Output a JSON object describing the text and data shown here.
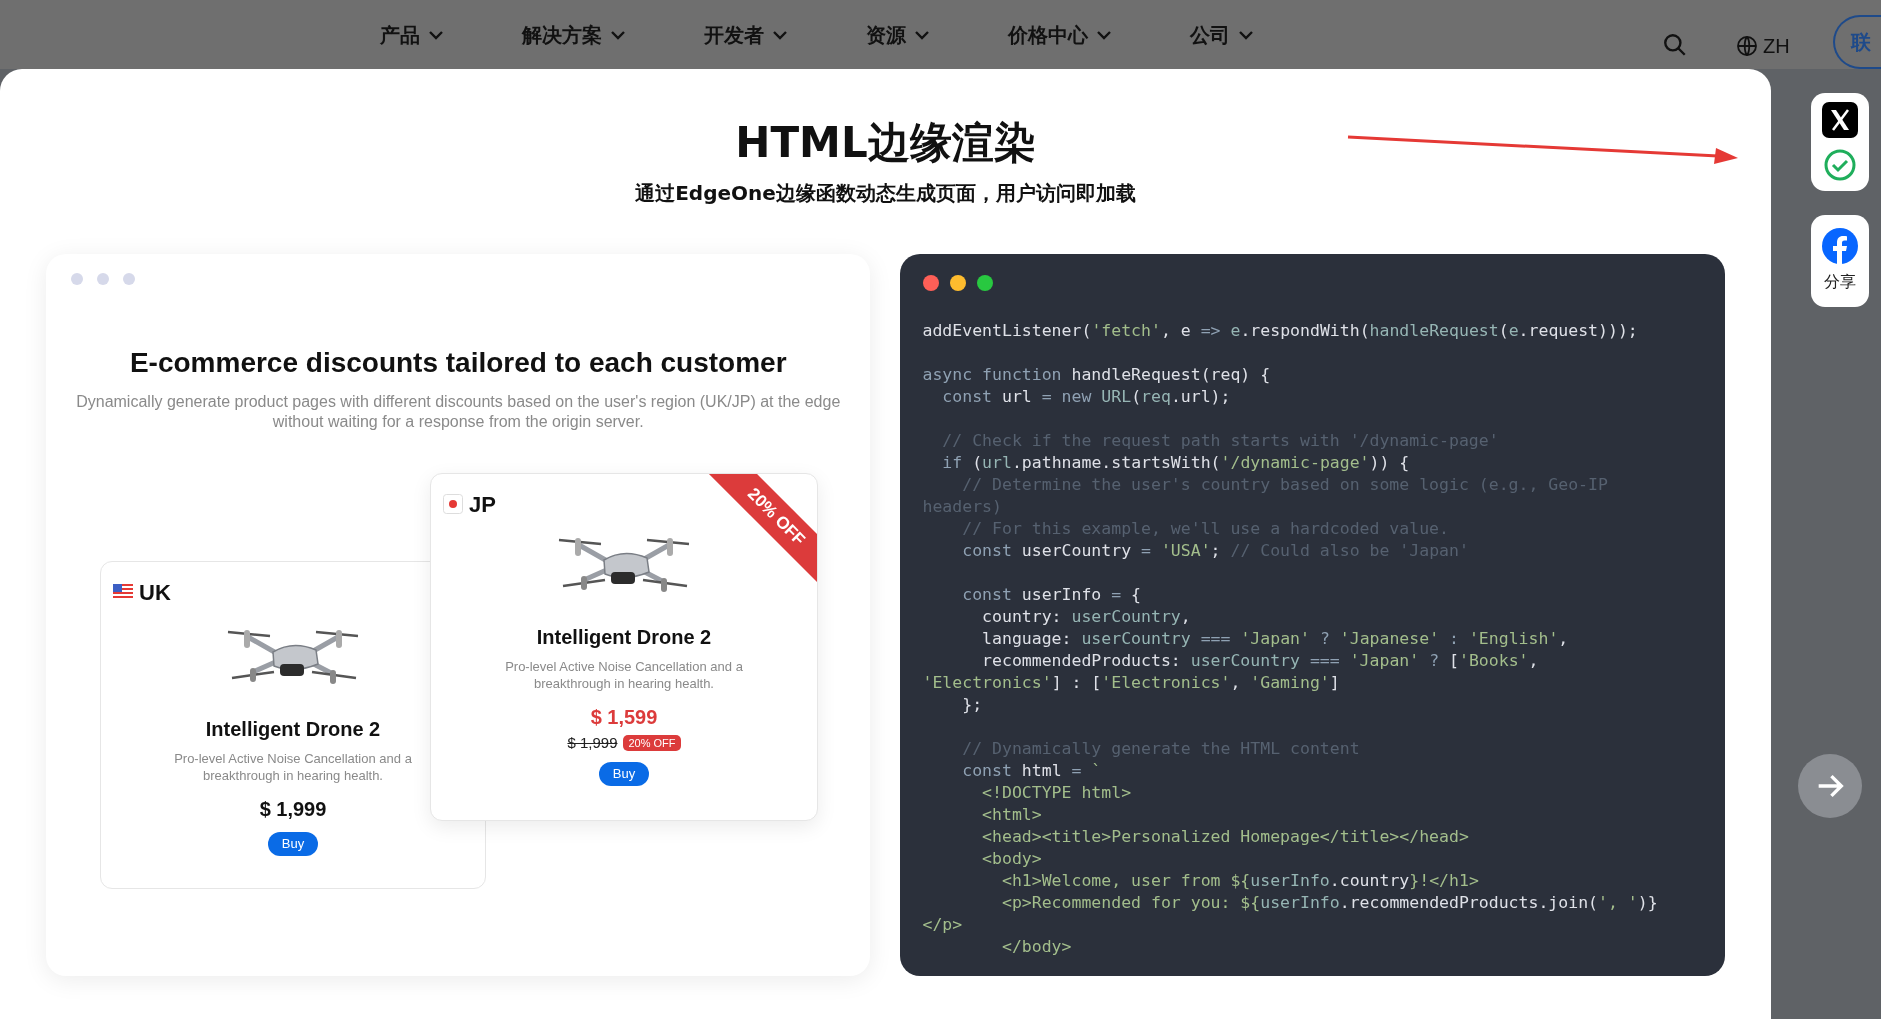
{
  "nav": {
    "items": [
      {
        "label": "产品"
      },
      {
        "label": "解决方案"
      },
      {
        "label": "开发者"
      },
      {
        "label": "资源"
      },
      {
        "label": "价格中心"
      },
      {
        "label": "公司"
      }
    ],
    "language": "ZH",
    "contact_button": "联"
  },
  "modal": {
    "title": "HTML边缘渲染",
    "subtitle": "通过EdgeOne边缘函数动态生成页面，用户访问即加载"
  },
  "demo": {
    "title": "E-commerce discounts tailored to each customer",
    "description": "Dynamically generate product pages with different discounts based on the user's region (UK/JP) at the edge without waiting for a response from the origin server.",
    "products": [
      {
        "kind": "regular",
        "region": "UK",
        "name": "Intelligent Drone 2",
        "description": "Pro-level Active Noise Cancellation and a breakthrough in hearing health.",
        "price": "$ 1,999",
        "buy": "Buy"
      },
      {
        "kind": "discount",
        "region": "JP",
        "ribbon": "20% OFF",
        "name": "Intelligent Drone 2",
        "description": "Pro-level Active Noise Cancellation and a breakthrough in hearing health.",
        "price": "$ 1,599",
        "original_price": "$ 1,999",
        "discount_badge": "20% OFF",
        "buy": "Buy"
      }
    ]
  },
  "code": {
    "lines": [
      {
        "kind": "code",
        "tokens": [
          {
            "kind": "plain",
            "text": "addEventListener("
          },
          {
            "kind": "string",
            "text": "'fetch'"
          },
          {
            "kind": "plain",
            "text": ", e "
          },
          {
            "kind": "keyword",
            "text": "=>"
          },
          {
            "kind": "name",
            "text": " e"
          },
          {
            "kind": "plain",
            "text": ".respondWith("
          },
          {
            "kind": "name",
            "text": "handleRequest"
          },
          {
            "kind": "plain",
            "text": "("
          },
          {
            "kind": "name",
            "text": "e"
          },
          {
            "kind": "plain",
            "text": ".request)));"
          }
        ]
      },
      {
        "kind": "blank"
      },
      {
        "kind": "code",
        "tokens": [
          {
            "kind": "keyword",
            "text": "async function"
          },
          {
            "kind": "plain",
            "text": " handleRequest(req) {"
          }
        ]
      },
      {
        "kind": "code",
        "tokens": [
          {
            "kind": "keyword",
            "text": "  const"
          },
          {
            "kind": "plain",
            "text": " url "
          },
          {
            "kind": "keyword",
            "text": "= new"
          },
          {
            "kind": "name",
            "text": " URL"
          },
          {
            "kind": "plain",
            "text": "("
          },
          {
            "kind": "name",
            "text": "req"
          },
          {
            "kind": "plain",
            "text": ".url);"
          }
        ]
      },
      {
        "kind": "blank"
      },
      {
        "kind": "code",
        "tokens": [
          {
            "kind": "comment",
            "text": "  // Check if the request path starts with '/dynamic-page'"
          }
        ]
      },
      {
        "kind": "code",
        "tokens": [
          {
            "kind": "keyword",
            "text": "  if"
          },
          {
            "kind": "plain",
            "text": " ("
          },
          {
            "kind": "name",
            "text": "url"
          },
          {
            "kind": "plain",
            "text": ".pathname.startsWith("
          },
          {
            "kind": "string",
            "text": "'/dynamic-page'"
          },
          {
            "kind": "plain",
            "text": ")) {"
          }
        ]
      },
      {
        "kind": "code",
        "tokens": [
          {
            "kind": "comment",
            "text": "    // Determine the user's country based on some logic (e.g., Geo-IP"
          }
        ]
      },
      {
        "kind": "code",
        "tokens": [
          {
            "kind": "comment",
            "text": "headers)"
          }
        ]
      },
      {
        "kind": "code",
        "tokens": [
          {
            "kind": "comment",
            "text": "    // For this example, we'll use a hardcoded value."
          }
        ]
      },
      {
        "kind": "code",
        "tokens": [
          {
            "kind": "keyword",
            "text": "    const"
          },
          {
            "kind": "plain",
            "text": " userCountry "
          },
          {
            "kind": "keyword",
            "text": "="
          },
          {
            "kind": "string",
            "text": " 'USA'"
          },
          {
            "kind": "plain",
            "text": ";"
          },
          {
            "kind": "comment",
            "text": " // Could also be 'Japan'"
          }
        ]
      },
      {
        "kind": "blank"
      },
      {
        "kind": "code",
        "tokens": [
          {
            "kind": "keyword",
            "text": "    const"
          },
          {
            "kind": "plain",
            "text": " userInfo "
          },
          {
            "kind": "keyword",
            "text": "="
          },
          {
            "kind": "plain",
            "text": " {"
          }
        ]
      },
      {
        "kind": "code",
        "tokens": [
          {
            "kind": "plain",
            "text": "      country: "
          },
          {
            "kind": "name",
            "text": "userCountry"
          },
          {
            "kind": "plain",
            "text": ","
          }
        ]
      },
      {
        "kind": "code",
        "tokens": [
          {
            "kind": "plain",
            "text": "      language: "
          },
          {
            "kind": "name",
            "text": "userCountry"
          },
          {
            "kind": "keyword",
            "text": " ==="
          },
          {
            "kind": "string",
            "text": " 'Japan'"
          },
          {
            "kind": "keyword",
            "text": " ?"
          },
          {
            "kind": "string",
            "text": " 'Japanese'"
          },
          {
            "kind": "keyword",
            "text": " :"
          },
          {
            "kind": "string",
            "text": " 'English'"
          },
          {
            "kind": "plain",
            "text": ","
          }
        ]
      },
      {
        "kind": "code",
        "tokens": [
          {
            "kind": "plain",
            "text": "      recommendedProducts: "
          },
          {
            "kind": "name",
            "text": "userCountry"
          },
          {
            "kind": "keyword",
            "text": " ==="
          },
          {
            "kind": "string",
            "text": " 'Japan'"
          },
          {
            "kind": "keyword",
            "text": " ?"
          },
          {
            "kind": "plain",
            "text": " ["
          },
          {
            "kind": "string",
            "text": "'Books'"
          },
          {
            "kind": "plain",
            "text": ","
          }
        ]
      },
      {
        "kind": "code",
        "tokens": [
          {
            "kind": "string",
            "text": "'Electronics'"
          },
          {
            "kind": "plain",
            "text": "] : ["
          },
          {
            "kind": "string",
            "text": "'Electronics'"
          },
          {
            "kind": "plain",
            "text": ", "
          },
          {
            "kind": "string",
            "text": "'Gaming'"
          },
          {
            "kind": "plain",
            "text": "]"
          }
        ]
      },
      {
        "kind": "code",
        "tokens": [
          {
            "kind": "plain",
            "text": "    };"
          }
        ]
      },
      {
        "kind": "blank"
      },
      {
        "kind": "code",
        "tokens": [
          {
            "kind": "comment",
            "text": "    // Dynamically generate the HTML content"
          }
        ]
      },
      {
        "kind": "code",
        "tokens": [
          {
            "kind": "keyword",
            "text": "    const"
          },
          {
            "kind": "plain",
            "text": " html "
          },
          {
            "kind": "keyword",
            "text": "="
          },
          {
            "kind": "string",
            "text": " `"
          }
        ]
      },
      {
        "kind": "code",
        "tokens": [
          {
            "kind": "string",
            "text": "      <!DOCTYPE html>"
          }
        ]
      },
      {
        "kind": "code",
        "tokens": [
          {
            "kind": "string",
            "text": "      <html>"
          }
        ]
      },
      {
        "kind": "code",
        "tokens": [
          {
            "kind": "string",
            "text": "      <head><title>Personalized Homepage</title></head>"
          }
        ]
      },
      {
        "kind": "code",
        "tokens": [
          {
            "kind": "string",
            "text": "      <body>"
          }
        ]
      },
      {
        "kind": "code",
        "tokens": [
          {
            "kind": "string",
            "text": "        <h1>Welcome, user from ${"
          },
          {
            "kind": "name",
            "text": "userInfo"
          },
          {
            "kind": "plain",
            "text": ".country"
          },
          {
            "kind": "string",
            "text": "}!</h1>"
          }
        ]
      },
      {
        "kind": "code",
        "tokens": [
          {
            "kind": "string",
            "text": "        <p>Recommended for you: ${"
          },
          {
            "kind": "name",
            "text": "userInfo"
          },
          {
            "kind": "plain",
            "text": ".recommendedProducts.join("
          },
          {
            "kind": "string",
            "text": "', '"
          },
          {
            "kind": "plain",
            "text": ")}"
          }
        ]
      },
      {
        "kind": "code",
        "tokens": [
          {
            "kind": "string",
            "text": "</p>"
          }
        ]
      },
      {
        "kind": "code",
        "tokens": [
          {
            "kind": "string",
            "text": "        </body>"
          }
        ]
      }
    ]
  },
  "share": {
    "label": "分享"
  }
}
